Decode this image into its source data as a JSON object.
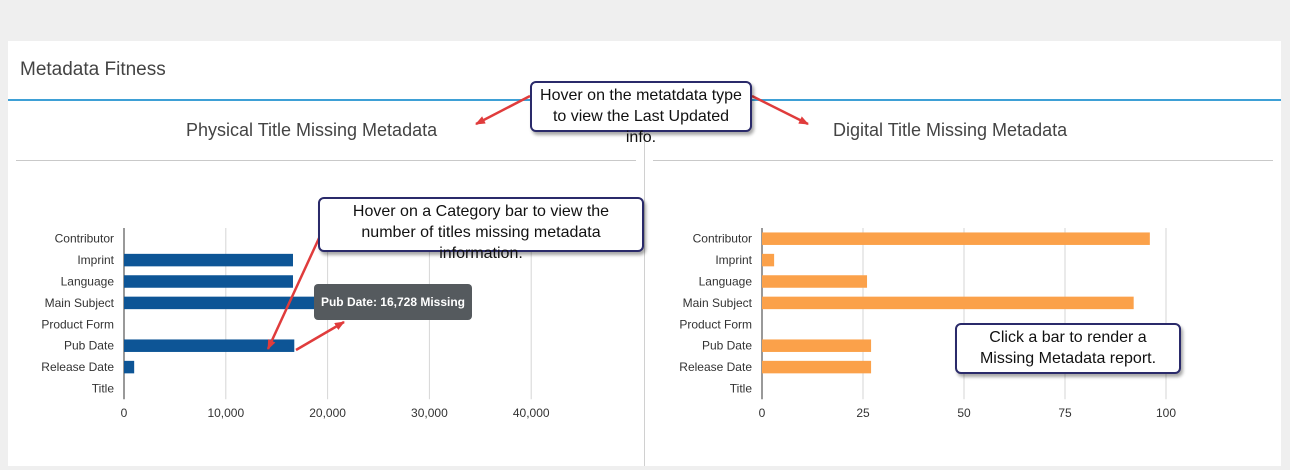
{
  "panel": {
    "title": "Metadata Fitness"
  },
  "callouts": {
    "metadata_type": "Hover on the metatdata type to view the Last Updated info.",
    "category_bar": "Hover on a Category bar to view the number of titles missing metadata information.",
    "click_bar": "Click a bar to render a Missing Metadata report."
  },
  "tooltip": {
    "text": "Pub Date: 16,728 Missing"
  },
  "colors": {
    "physical": "#0d5596",
    "digital": "#fba14a",
    "accent": "#3ea0d6",
    "annotation_arrow": "#e03c3c"
  },
  "chart_data": [
    {
      "type": "bar",
      "orientation": "horizontal",
      "title": "Physical Title Missing Metadata",
      "categories": [
        "Contributor",
        "Imprint",
        "Language",
        "Main Subject",
        "Product Form",
        "Pub Date",
        "Release Date",
        "Title"
      ],
      "values": [
        0,
        16600,
        16600,
        22500,
        0,
        16728,
        1000,
        0
      ],
      "xlim": [
        0,
        50000
      ],
      "xticks": [
        0,
        10000,
        20000,
        30000,
        40000
      ],
      "xtick_labels": [
        "0",
        "10,000",
        "20,000",
        "30,000",
        "40,000"
      ],
      "grid": true
    },
    {
      "type": "bar",
      "orientation": "horizontal",
      "title": "Digital Title Missing Metadata",
      "categories": [
        "Contributor",
        "Imprint",
        "Language",
        "Main Subject",
        "Product Form",
        "Pub Date",
        "Release Date",
        "Title"
      ],
      "values": [
        96,
        3,
        26,
        92,
        0,
        27,
        27,
        0
      ],
      "xlim": [
        0,
        125
      ],
      "xticks": [
        0,
        25,
        50,
        75,
        100
      ],
      "xtick_labels": [
        "0",
        "25",
        "50",
        "75",
        "100"
      ],
      "grid": true
    }
  ]
}
